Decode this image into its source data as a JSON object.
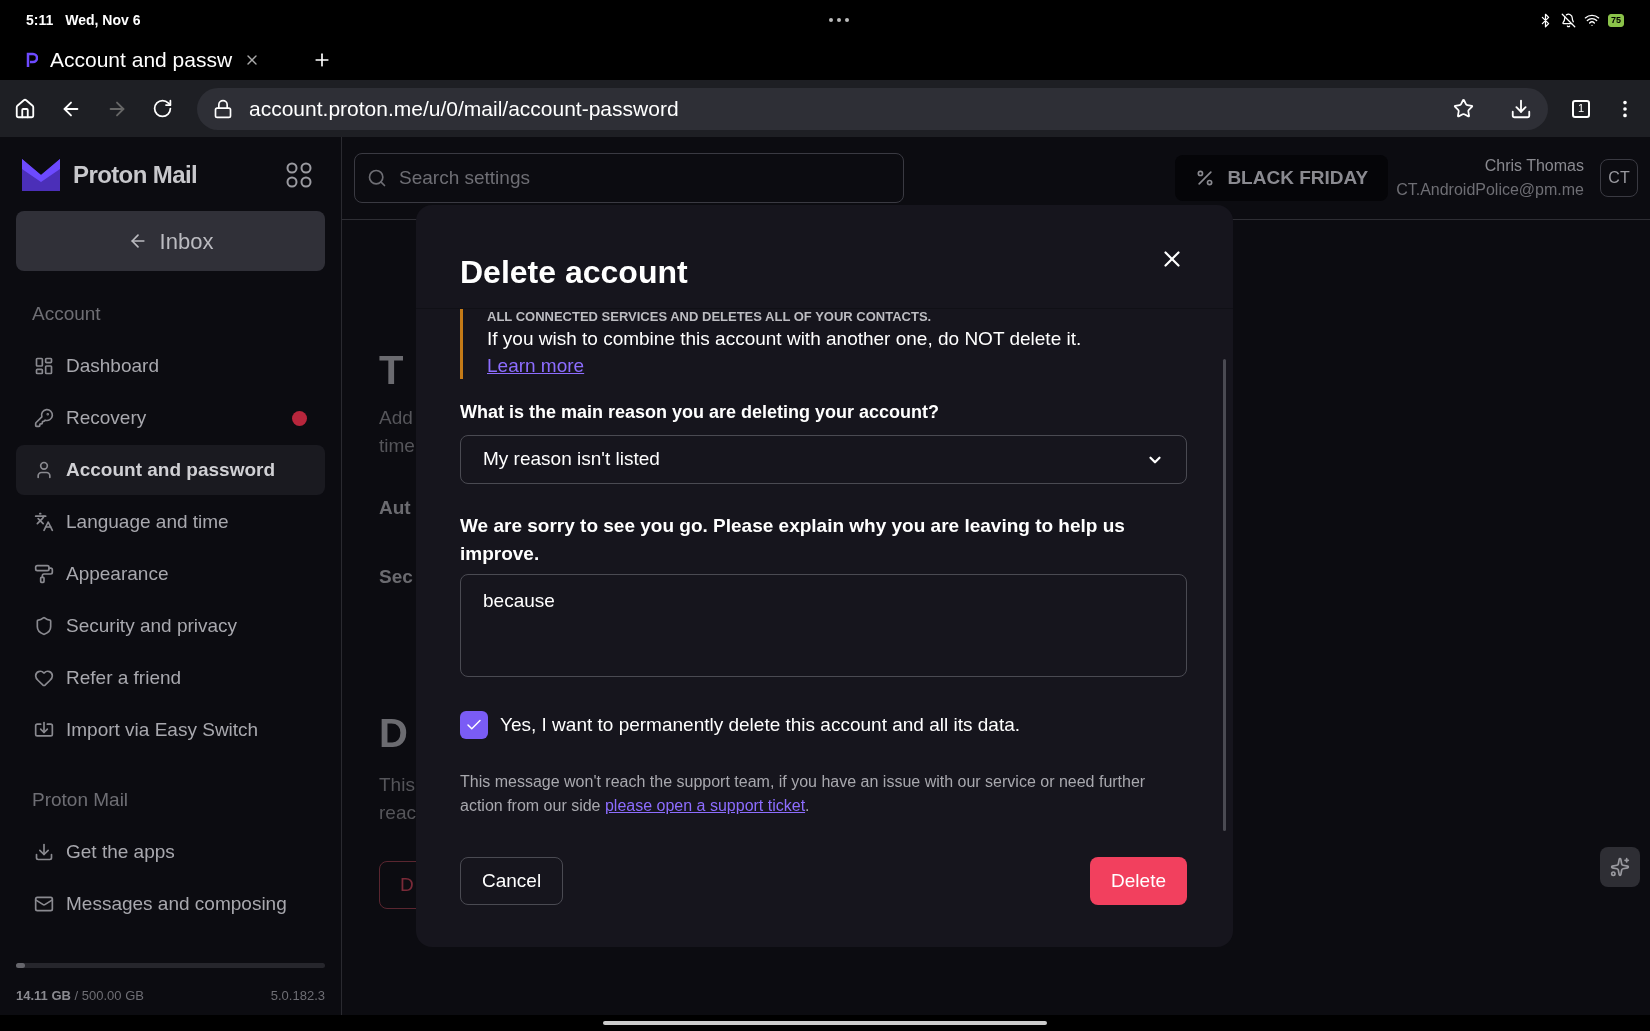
{
  "status_bar": {
    "time": "5:11",
    "date": "Wed, Nov 6",
    "battery": "75"
  },
  "browser": {
    "tab": {
      "title": "Account and passw"
    },
    "url": "account.proton.me/u/0/mail/account-password",
    "tab_count": "1"
  },
  "sidebar": {
    "app_name": "Proton Mail",
    "inbox_button": "Inbox",
    "sections": [
      {
        "title": "Account",
        "items": [
          {
            "label": "Dashboard",
            "selected": false,
            "notification": false
          },
          {
            "label": "Recovery",
            "selected": false,
            "notification": true
          },
          {
            "label": "Account and password",
            "selected": true,
            "notification": false
          },
          {
            "label": "Language and time",
            "selected": false,
            "notification": false
          },
          {
            "label": "Appearance",
            "selected": false,
            "notification": false
          },
          {
            "label": "Security and privacy",
            "selected": false,
            "notification": false
          },
          {
            "label": "Refer a friend",
            "selected": false,
            "notification": false
          },
          {
            "label": "Import via Easy Switch",
            "selected": false,
            "notification": false
          }
        ]
      },
      {
        "title": "Proton Mail",
        "items": [
          {
            "label": "Get the apps",
            "selected": false,
            "notification": false
          },
          {
            "label": "Messages and composing",
            "selected": false,
            "notification": false
          }
        ]
      }
    ],
    "storage": {
      "used": "14.11 GB",
      "total": "/ 500.00 GB",
      "level": 0.03,
      "version": "5.0.182.3"
    }
  },
  "header": {
    "search_placeholder": "Search settings",
    "promo": "BLACK FRIDAY",
    "user_name": "Chris Thomas",
    "user_email": "CT.AndroidPolice@pm.me",
    "initials": "CT"
  },
  "page_behind": [
    {
      "kind": "heading",
      "text": "T"
    },
    {
      "kind": "text",
      "text": "Add"
    },
    {
      "kind": "text",
      "text": "time"
    },
    {
      "kind": "label",
      "text": "Aut"
    },
    {
      "kind": "label",
      "text": "Sec"
    },
    {
      "kind": "heading",
      "text": "D"
    },
    {
      "kind": "text",
      "text": "This"
    },
    {
      "kind": "text",
      "text": "reac"
    },
    {
      "kind": "button",
      "text": "D"
    }
  ],
  "modal": {
    "title": "Delete account",
    "warning_cut": "ALL CONNECTED SERVICES AND DELETES ALL OF YOUR CONTACTS.",
    "warning": "If you wish to combine this account with another one, do NOT delete it.",
    "learn_more": "Learn more",
    "reason_label": "What is the main reason you are deleting your account?",
    "reason_value": "My reason isn't listed",
    "explain_label": "We are sorry to see you go. Please explain why you are leaving to help us improve.",
    "explain_value": "because",
    "confirm": {
      "label": "Yes, I want to permanently delete this account and all its data.",
      "checked": true
    },
    "note": "This message won't reach the support team, if you have an issue with our service or need further action from our side",
    "note_link": "please open a support ticket",
    "note_end": ".",
    "cancel": "Cancel",
    "delete": "Delete"
  }
}
